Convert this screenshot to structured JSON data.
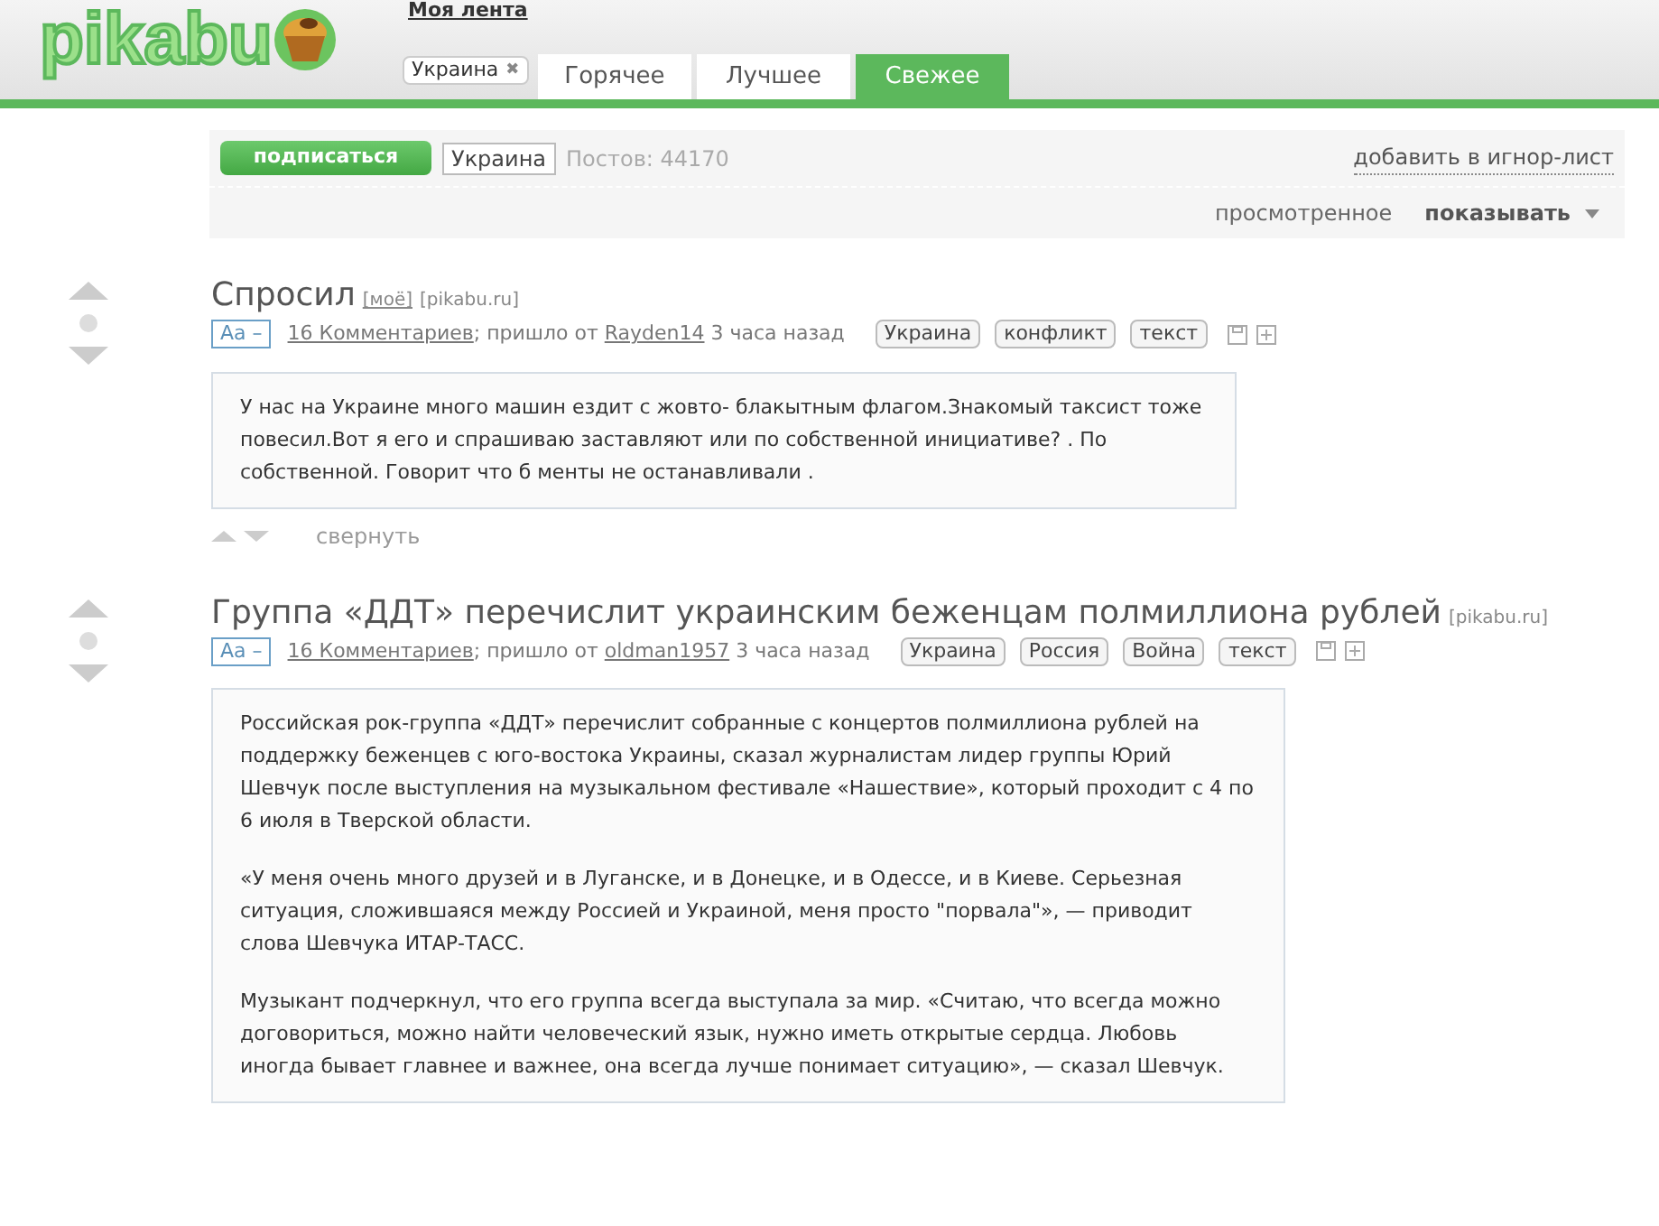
{
  "header": {
    "logo": "pikabu",
    "top_link": "Моя лента",
    "filter_tag": "Украина",
    "filter_remove": "✖",
    "tabs": [
      {
        "label": "Горячее",
        "selected": false
      },
      {
        "label": "Лучшее",
        "selected": false
      },
      {
        "label": "Свежее",
        "selected": true
      }
    ]
  },
  "tag_bar": {
    "subscribe": "подписаться",
    "tag": "Украина",
    "posts_count": "Постов: 44170",
    "ignore_link": "добавить в игнор-лист",
    "viewed": "просмотренное",
    "show": "показывать"
  },
  "posts": [
    {
      "title": "Спросил",
      "sources": [
        "[моё]",
        "[pikabu.ru]"
      ],
      "font_toggle": "Аа –",
      "comments": "16 Комментариев",
      "from": "; пришло от",
      "author": "Rayden14",
      "time": "3 часа назад",
      "tags": [
        "Украина",
        "конфликт",
        "текст"
      ],
      "paragraphs": [
        "У нас на Украине много машин ездит с жовто- блакытным флагом.Знакомый таксист тоже повесил.Вот я его и спрашиваю заставляют или по собственной инициативе? . По собственной. Говорит что б менты не останавливали ."
      ],
      "collapse": "свернуть"
    },
    {
      "title": "Группа «ДДТ» перечислит украинским беженцам полмиллиона рублей",
      "sources": [
        "[pikabu.ru]"
      ],
      "font_toggle": "Аа –",
      "comments": "16 Комментариев",
      "from": "; пришло от",
      "author": "oldman1957",
      "time": "3 часа назад",
      "tags": [
        "Украина",
        "Россия",
        "Война",
        "текст"
      ],
      "paragraphs": [
        "Российская рок-группа «ДДТ» перечислит собранные с концертов полмиллиона рублей на поддержку беженцев с юго-востока Украины, сказал журналистам лидер группы Юрий Шевчук после выступления на музыкальном фестивале «Нашествие», который проходит с 4 по 6 июля в Тверской области.",
        "«У меня очень много друзей и в Луганске, и в Донецке, и в Одессе, и в Киеве. Серьезная ситуация, сложившаяся между Россией и Украиной, меня просто \"порвала\"», — приводит слова Шевчука ИТАР-ТАСС.",
        "Музыкант подчеркнул, что его группа всегда выступала за мир. «Считаю, что всегда можно договориться, можно найти человеческий язык, нужно иметь открытые сердца. Любовь иногда бывает главнее и важнее, она всегда лучше понимает ситуацию», — сказал Шевчук."
      ]
    }
  ]
}
